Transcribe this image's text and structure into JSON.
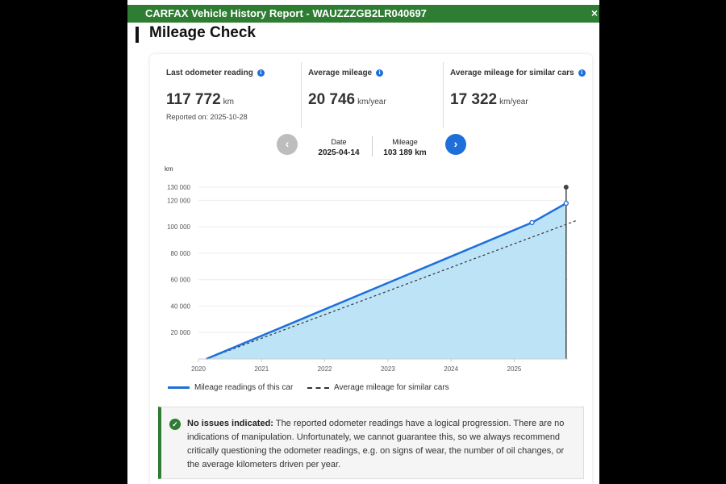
{
  "header": {
    "title": "CARFAX Vehicle History Report - WAUZZZGB2LR040697",
    "close_glyph": "×"
  },
  "section": {
    "title": "Mileage Check"
  },
  "stats": [
    {
      "label": "Last odometer reading",
      "value": "117 772",
      "unit": "km",
      "sub": "Reported on: 2025-10-28"
    },
    {
      "label": "Average mileage",
      "value": "20 746",
      "unit": "km/year"
    },
    {
      "label": "Average mileage for similar cars",
      "value": "17 322",
      "unit": "km/year"
    }
  ],
  "info_glyph": "i",
  "navigator": {
    "prev_glyph": "‹",
    "next_glyph": "›",
    "date_label": "Date",
    "date_value": "2025-04-14",
    "mileage_label": "Mileage",
    "mileage_value": "103 189 km"
  },
  "chart_data": {
    "type": "area",
    "ylabel": "km",
    "ylim": [
      0,
      130000
    ],
    "yticks": [
      {
        "value": 20000,
        "label": "20 000"
      },
      {
        "value": 40000,
        "label": "40 000"
      },
      {
        "value": 60000,
        "label": "60 000"
      },
      {
        "value": 80000,
        "label": "80 000"
      },
      {
        "value": 100000,
        "label": "100 000"
      },
      {
        "value": 120000,
        "label": "120 000"
      },
      {
        "value": 130000,
        "label": "130 000"
      }
    ],
    "xlim": [
      2020,
      2025.85
    ],
    "xticks": [
      "2020",
      "2021",
      "2022",
      "2023",
      "2024",
      "2025"
    ],
    "series": [
      {
        "name": "Mileage readings of this car",
        "color": "#1e6fd9",
        "style": "solid-area",
        "points": [
          {
            "x": "2020-02-15",
            "y": 0
          },
          {
            "x": "2025-04-14",
            "y": 103189
          },
          {
            "x": "2025-10-28",
            "y": 117772
          }
        ]
      },
      {
        "name": "Average mileage for similar cars",
        "color": "#333333",
        "style": "dashed",
        "points": [
          {
            "x": "2020-02-15",
            "y": 0
          },
          {
            "x": "2026-01-01",
            "y": 105000
          }
        ]
      }
    ],
    "marker": {
      "x": "2025-10-28",
      "y": 130000
    }
  },
  "alert": {
    "check_glyph": "✓",
    "title": "No issues indicated:",
    "body": "The reported odometer readings have a logical progression. There are no indications of manipulation. Unfortunately, we cannot guarantee this, so we always recommend critically questioning the odometer readings, e.g. on signs of wear, the number of oil changes, or the average kilometers driven per year."
  },
  "colors": {
    "brand_green": "#2e7d32",
    "accent_blue": "#1e6fd9",
    "area_fill": "#bde3f7"
  }
}
